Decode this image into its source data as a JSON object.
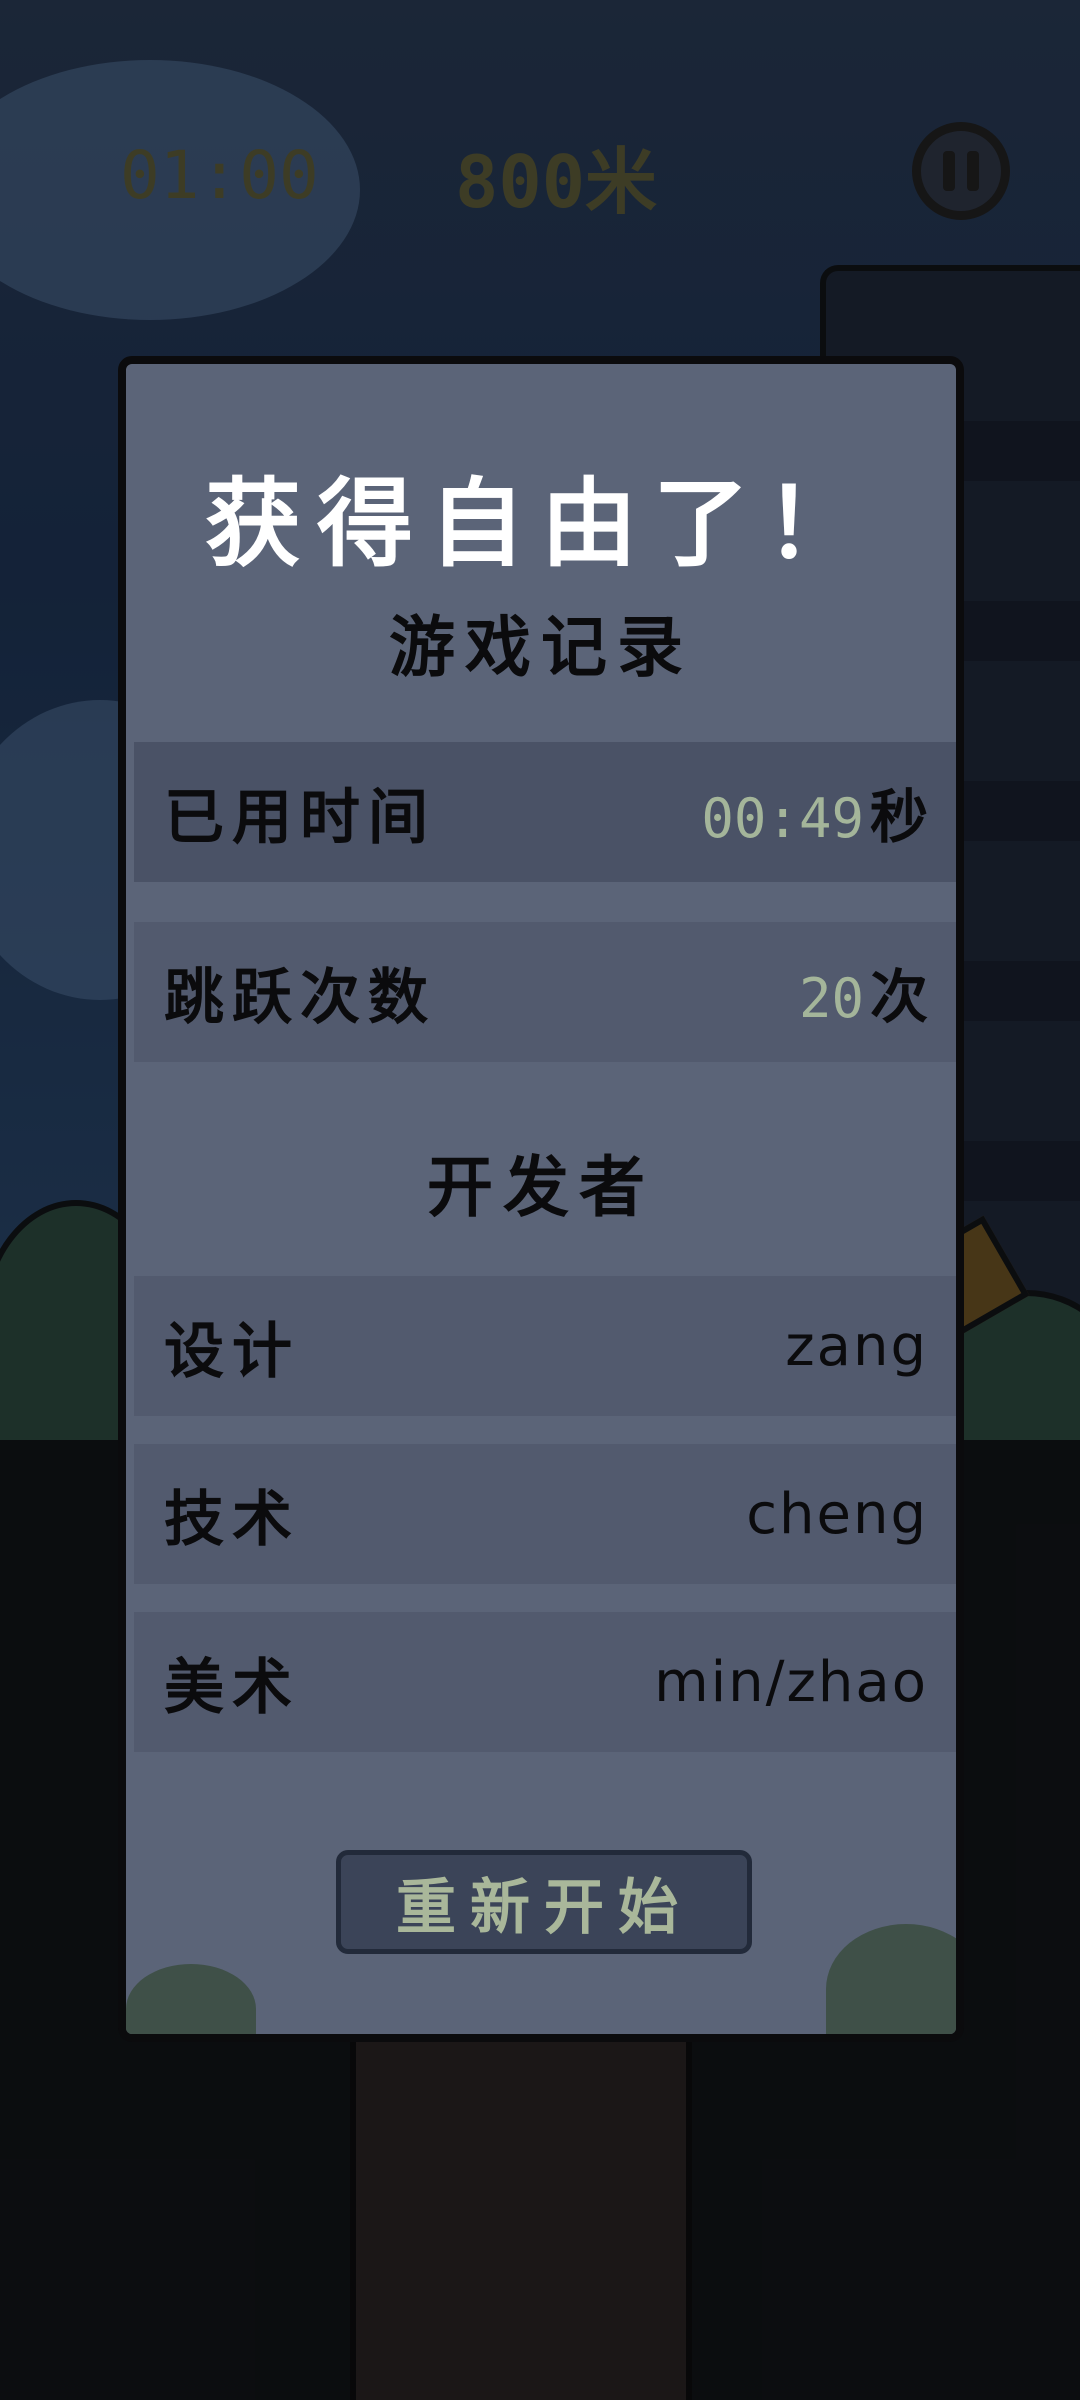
{
  "hud": {
    "timer": "01:00",
    "distance": "800米"
  },
  "dialog": {
    "title": "获得自由了！",
    "record_heading": "游戏记录",
    "stats": [
      {
        "label": "已用时间",
        "value": "00:49",
        "unit": "秒"
      },
      {
        "label": "跳跃次数",
        "value": "20",
        "unit": "次"
      }
    ],
    "developer_heading": "开发者",
    "credits": [
      {
        "label": "设计",
        "value": "zang"
      },
      {
        "label": "技术",
        "value": "cheng"
      },
      {
        "label": "美术",
        "value": "min/zhao"
      }
    ],
    "restart_label": "重新开始"
  },
  "colors": {
    "panel": "#5b6478",
    "highlight_number": "#a4b59a",
    "title": "#ffffff"
  },
  "icons": {
    "pause": "pause-icon"
  }
}
